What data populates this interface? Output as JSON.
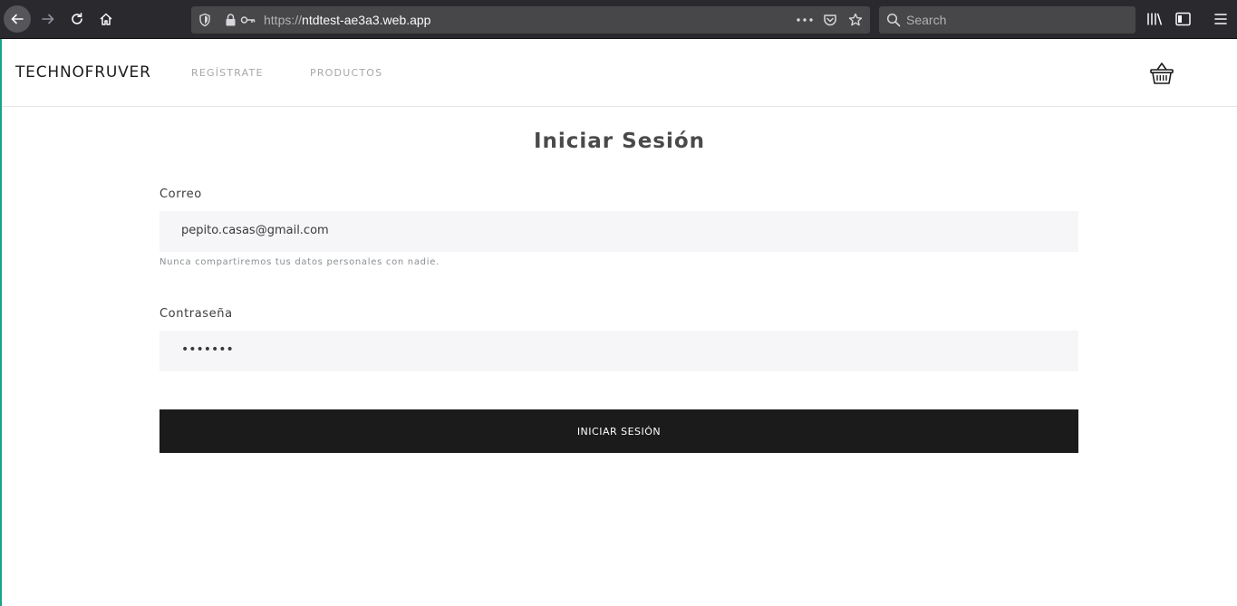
{
  "browser": {
    "url_scheme": "https://",
    "url_host": "ntdtest-ae3a3.web.app",
    "search_placeholder": "Search"
  },
  "site": {
    "brand": "TECHNOFRUVER",
    "nav": {
      "registrate": "REGÍSTRATE",
      "productos": "PRODUCTOS"
    }
  },
  "form": {
    "title": "Iniciar Sesión",
    "email_label": "Correo",
    "email_value": "pepito.casas@gmail.com",
    "email_help": "Nunca compartiremos tus datos personales con nadie.",
    "password_label": "Contraseña",
    "password_masked": "•••••••",
    "submit_label": "INICIAR SESIÓN"
  },
  "colors": {
    "browser_bg": "#2a2a2e",
    "input_bg": "#f6f6f8",
    "button_bg": "#1b1b1b",
    "accent_edge": "#17a589"
  },
  "icons": [
    "back-arrow-icon",
    "forward-arrow-icon",
    "reload-icon",
    "home-icon",
    "shield-icon",
    "lock-icon",
    "key-icon",
    "more-icon",
    "pocket-icon",
    "star-icon",
    "search-icon",
    "library-icon",
    "sidebar-icon",
    "menu-icon",
    "basket-icon"
  ]
}
